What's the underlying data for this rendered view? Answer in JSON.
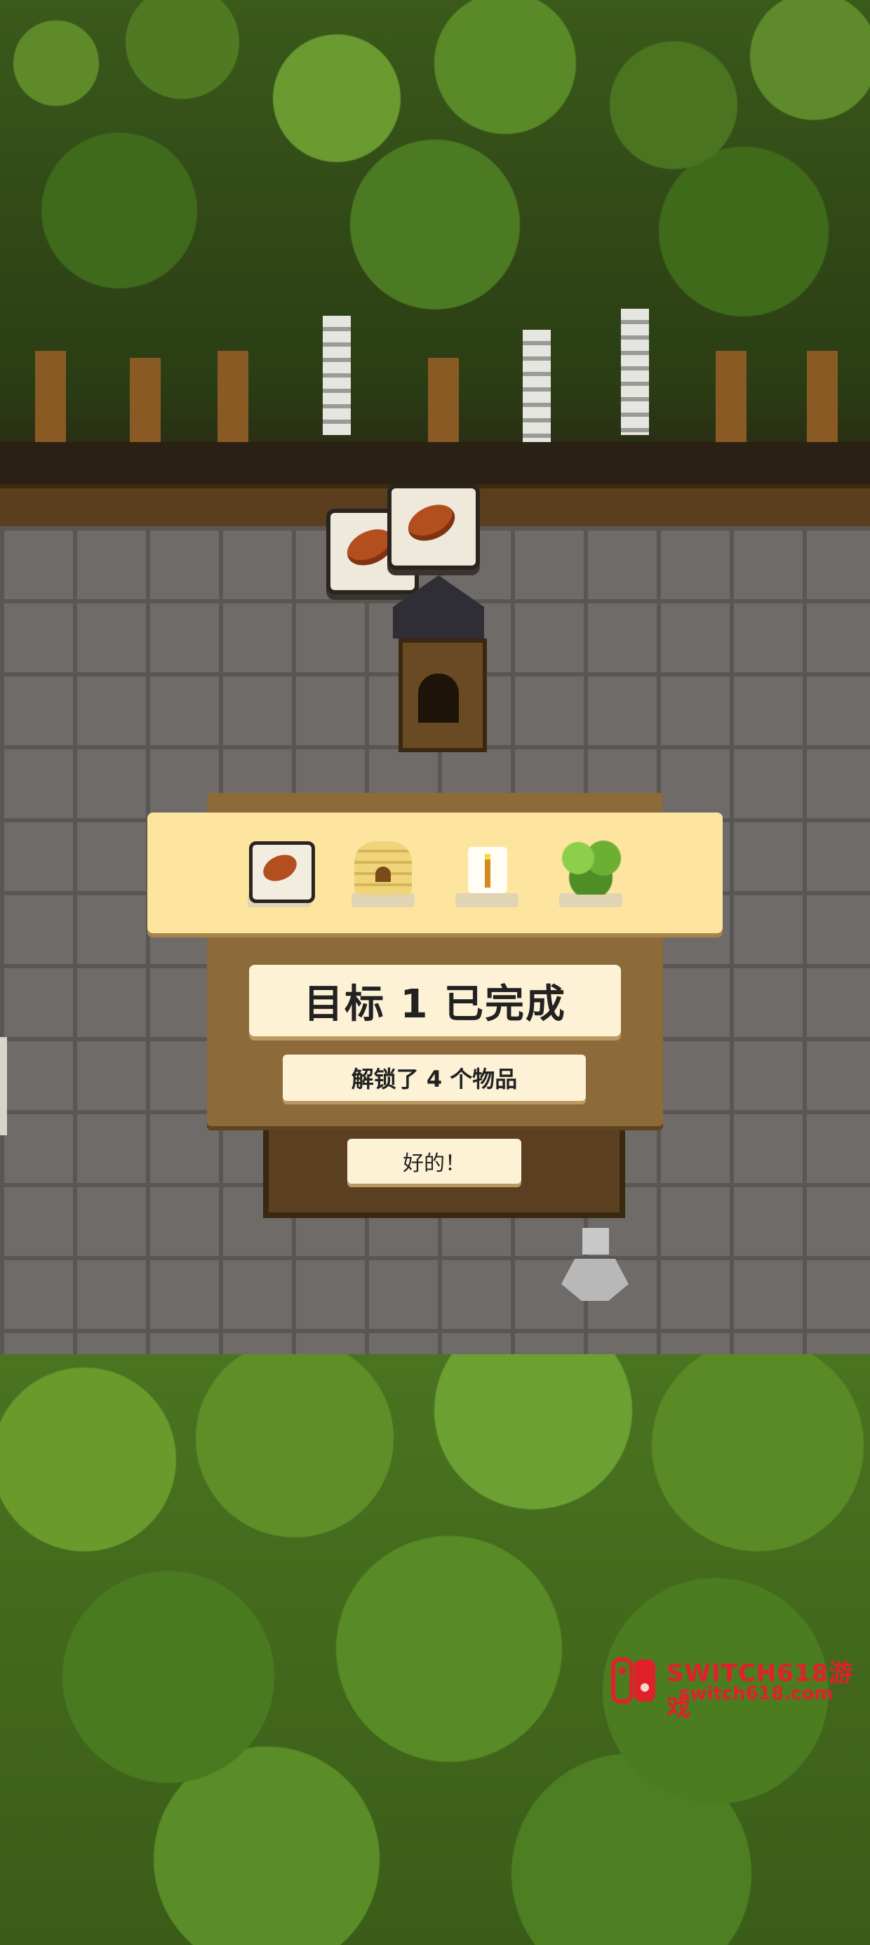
{
  "modal": {
    "title": "目标 1 已完成",
    "subtitle": "解锁了 4 个物品",
    "ok_label": "好的！",
    "rewards": [
      {
        "icon": "bread-sack-icon"
      },
      {
        "icon": "beehive-icon"
      },
      {
        "icon": "candle-icon"
      },
      {
        "icon": "bush-icon"
      }
    ]
  },
  "watermark": {
    "line1": "SWITCH618游戏",
    "line2": "switch618.com"
  },
  "colors": {
    "modal_panel": "#8c6a3a",
    "card_bg": "#fdf1d6",
    "rewards_bg": "#fde5a0",
    "watermark_red": "#e0202a"
  }
}
